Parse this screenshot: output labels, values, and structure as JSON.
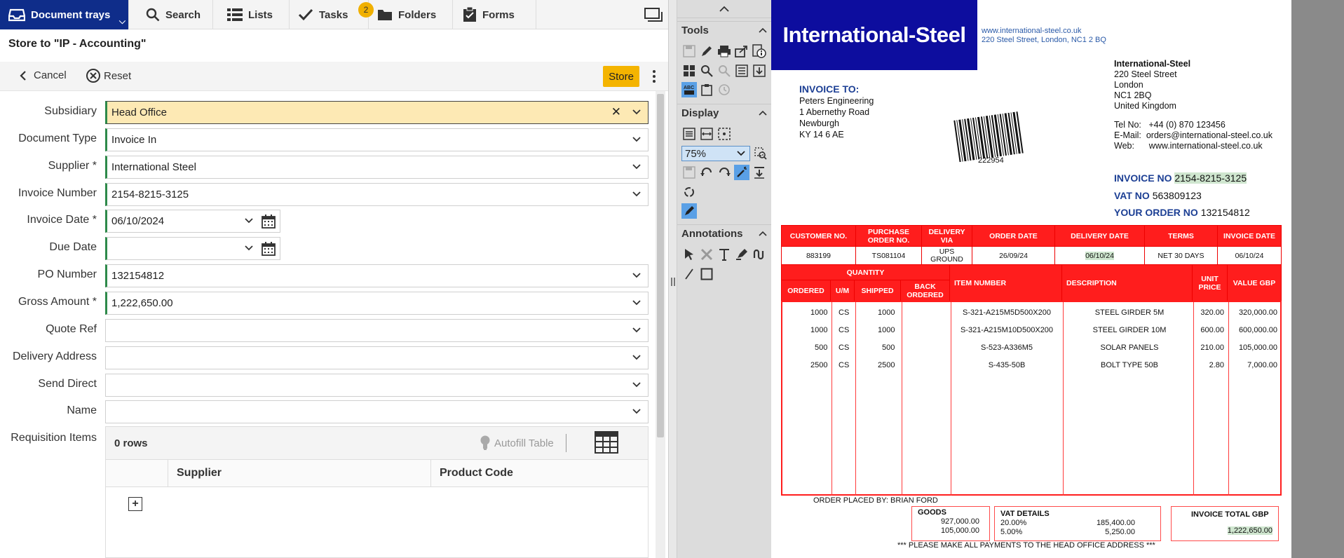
{
  "nav": {
    "document_trays": "Document trays",
    "search": "Search",
    "lists": "Lists",
    "tasks": "Tasks",
    "tasks_badge": "2",
    "folders": "Folders",
    "forms": "Forms"
  },
  "form": {
    "title": "Store to \"IP - Accounting\"",
    "cancel": "Cancel",
    "reset": "Reset",
    "store": "Store",
    "fields": {
      "subsidiary": {
        "label": "Subsidiary",
        "value": "Head Office"
      },
      "document_type": {
        "label": "Document Type",
        "value": "Invoice In"
      },
      "supplier": {
        "label": "Supplier *",
        "value": "International Steel"
      },
      "invoice_number": {
        "label": "Invoice Number",
        "value": "2154-8215-3125"
      },
      "invoice_date": {
        "label": "Invoice Date *",
        "value": "06/10/2024"
      },
      "due_date": {
        "label": "Due Date",
        "value": ""
      },
      "po_number": {
        "label": "PO Number",
        "value": "132154812"
      },
      "gross_amount": {
        "label": "Gross Amount *",
        "value": "1,222,650.00"
      },
      "quote_ref": {
        "label": "Quote Ref",
        "value": ""
      },
      "delivery_address": {
        "label": "Delivery Address",
        "value": ""
      },
      "send_direct": {
        "label": "Send Direct",
        "value": ""
      },
      "name": {
        "label": "Name",
        "value": ""
      }
    },
    "requisition": {
      "label": "Requisition Items",
      "rows": "0 rows",
      "autofill": "Autofill Table",
      "col_supplier": "Supplier",
      "col_product_code": "Product Code"
    }
  },
  "tools": {
    "tools_header": "Tools",
    "display_header": "Display",
    "zoom": "75%",
    "annotations_header": "Annotations"
  },
  "invoice": {
    "logo": "International-Steel",
    "web": "www.international-steel.co.uk",
    "address_line": "220 Steel Street, London, NC1 2 BQ",
    "company": {
      "name": "International-Steel",
      "lines": [
        "220 Steel Street",
        "London",
        "NC1 2BQ",
        "United Kingdom"
      ]
    },
    "contact": {
      "tel_label": "Tel No:",
      "tel": "+44 (0) 870 123456",
      "email_label": "E-Mail:",
      "email": "orders@international-steel.co.uk",
      "web_label": "Web:",
      "web": "www.international-steel.co.uk"
    },
    "invoice_to": "INVOICE TO:",
    "bill_to": [
      "Peters Engineering",
      "1 Abernethy Road",
      "Newburgh",
      "KY 14 6 AE"
    ],
    "barcode_number": "222954",
    "invoice_no_label": "INVOICE NO",
    "invoice_no": "2154-8215-3125",
    "vat_no_label": "VAT NO",
    "vat_no": "563809123",
    "your_order_label": "YOUR ORDER NO",
    "your_order": "132154812",
    "header_cols": [
      "CUSTOMER NO.",
      "PURCHASE ORDER NO.",
      "DELIVERY VIA",
      "ORDER DATE",
      "DELIVERY DATE",
      "TERMS",
      "INVOICE DATE"
    ],
    "header_vals": [
      "883199",
      "TS081104",
      "UPS GROUND",
      "26/09/24",
      "06/10/24",
      "NET 30 DAYS",
      "06/10/24"
    ],
    "item_head": {
      "quantity": "QUANTITY",
      "ordered": "ORDERED",
      "um": "U/M",
      "shipped": "SHIPPED",
      "back_ordered": "BACK ORDERED",
      "item_number": "ITEM NUMBER",
      "description": "DESCRIPTION",
      "unit_price": "UNIT PRICE",
      "value_gbp": "VALUE GBP"
    },
    "items": [
      {
        "ordered": "1000",
        "um": "CS",
        "shipped": "1000",
        "item": "S-321-A215M5D500X200",
        "desc": "STEEL GIRDER 5M",
        "price": "320.00",
        "value": "320,000.00"
      },
      {
        "ordered": "1000",
        "um": "CS",
        "shipped": "1000",
        "item": "S-321-A215M10D500X200",
        "desc": "STEEL GIRDER 10M",
        "price": "600.00",
        "value": "600,000.00"
      },
      {
        "ordered": "500",
        "um": "CS",
        "shipped": "500",
        "item": "S-523-A336M5",
        "desc": "SOLAR PANELS",
        "price": "210.00",
        "value": "105,000.00"
      },
      {
        "ordered": "2500",
        "um": "CS",
        "shipped": "2500",
        "item": "S-435-50B",
        "desc": "BOLT TYPE 50B",
        "price": "2.80",
        "value": "7,000.00"
      }
    ],
    "order_placed_by": "ORDER PLACED BY: BRIAN FORD",
    "goods_label": "GOODS",
    "goods_values": [
      "927,000.00",
      "105,000.00"
    ],
    "vat_label": "VAT DETAILS",
    "vat_rows": [
      {
        "rate": "20.00%",
        "amount": "185,400.00"
      },
      {
        "rate": "5.00%",
        "amount": "5,250.00"
      }
    ],
    "total_label": "INVOICE TOTAL GBP",
    "total": "1,222,650.00",
    "footer": "*** PLEASE MAKE ALL PAYMENTS TO THE HEAD OFFICE ADDRESS ***"
  }
}
